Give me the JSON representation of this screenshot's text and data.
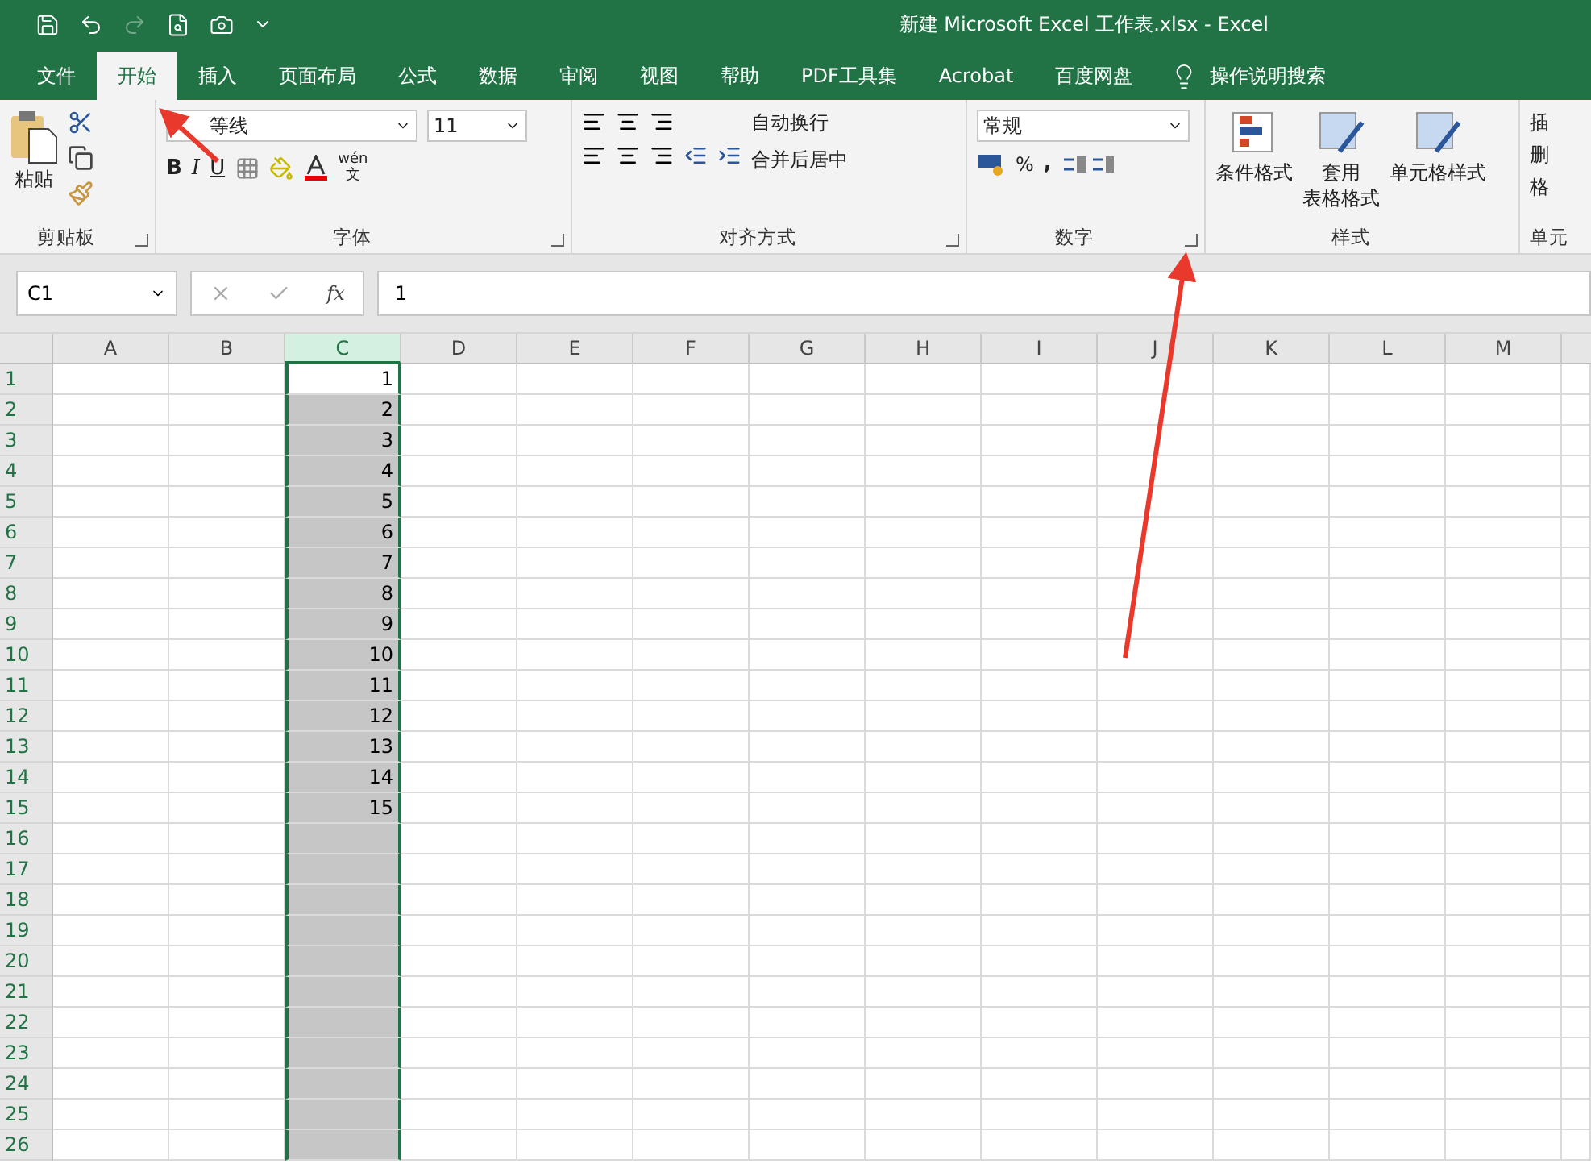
{
  "window": {
    "title": "新建 Microsoft Excel 工作表.xlsx  -  Excel"
  },
  "tabs": [
    {
      "label": "文件",
      "selected": false
    },
    {
      "label": "开始",
      "selected": true
    },
    {
      "label": "插入",
      "selected": false
    },
    {
      "label": "页面布局",
      "selected": false
    },
    {
      "label": "公式",
      "selected": false
    },
    {
      "label": "数据",
      "selected": false
    },
    {
      "label": "审阅",
      "selected": false
    },
    {
      "label": "视图",
      "selected": false
    },
    {
      "label": "帮助",
      "selected": false
    },
    {
      "label": "PDF工具集",
      "selected": false
    },
    {
      "label": "Acrobat",
      "selected": false
    },
    {
      "label": "百度网盘",
      "selected": false
    }
  ],
  "tell_me": "操作说明搜索",
  "ribbon": {
    "clipboard": {
      "paste": "粘贴",
      "label": "剪贴板"
    },
    "font": {
      "font_name": "等线",
      "font_size": "11",
      "bold": "B",
      "italic": "I",
      "underline": "U",
      "phonetic": "wén",
      "phonetic_char": "文",
      "label": "字体"
    },
    "alignment": {
      "wrap": "自动换行",
      "merge": "合并后居中",
      "label": "对齐方式"
    },
    "number": {
      "format": "常规",
      "percent": "%",
      "comma": ",",
      "label": "数字"
    },
    "styles": {
      "conditional": "条件格式",
      "table_line1": "套用",
      "table_line2": "表格格式",
      "cell_styles": "单元格样式",
      "label": "样式"
    },
    "cells": {
      "insert": "插",
      "delete": "删",
      "format": "格",
      "label": "单元"
    }
  },
  "formula_bar": {
    "name_box": "C1",
    "fx": "fx",
    "value": "1"
  },
  "columns": [
    {
      "label": "A",
      "selected": false
    },
    {
      "label": "B",
      "selected": false
    },
    {
      "label": "C",
      "selected": true
    },
    {
      "label": "D",
      "selected": false
    },
    {
      "label": "E",
      "selected": false
    },
    {
      "label": "F",
      "selected": false
    },
    {
      "label": "G",
      "selected": false
    },
    {
      "label": "H",
      "selected": false
    },
    {
      "label": "I",
      "selected": false
    },
    {
      "label": "J",
      "selected": false
    },
    {
      "label": "K",
      "selected": false
    },
    {
      "label": "L",
      "selected": false
    },
    {
      "label": "M",
      "selected": false
    }
  ],
  "rows": [
    {
      "number": "1",
      "c": "1"
    },
    {
      "number": "2",
      "c": "2"
    },
    {
      "number": "3",
      "c": "3"
    },
    {
      "number": "4",
      "c": "4"
    },
    {
      "number": "5",
      "c": "5"
    },
    {
      "number": "6",
      "c": "6"
    },
    {
      "number": "7",
      "c": "7"
    },
    {
      "number": "8",
      "c": "8"
    },
    {
      "number": "9",
      "c": "9"
    },
    {
      "number": "10",
      "c": "10"
    },
    {
      "number": "11",
      "c": "11"
    },
    {
      "number": "12",
      "c": "12"
    },
    {
      "number": "13",
      "c": "13"
    },
    {
      "number": "14",
      "c": "14"
    },
    {
      "number": "15",
      "c": "15"
    },
    {
      "number": "16"
    },
    {
      "number": "17"
    },
    {
      "number": "18"
    },
    {
      "number": "19"
    },
    {
      "number": "20"
    },
    {
      "number": "21"
    },
    {
      "number": "22"
    },
    {
      "number": "23"
    },
    {
      "number": "24"
    },
    {
      "number": "25"
    },
    {
      "number": "26"
    }
  ]
}
